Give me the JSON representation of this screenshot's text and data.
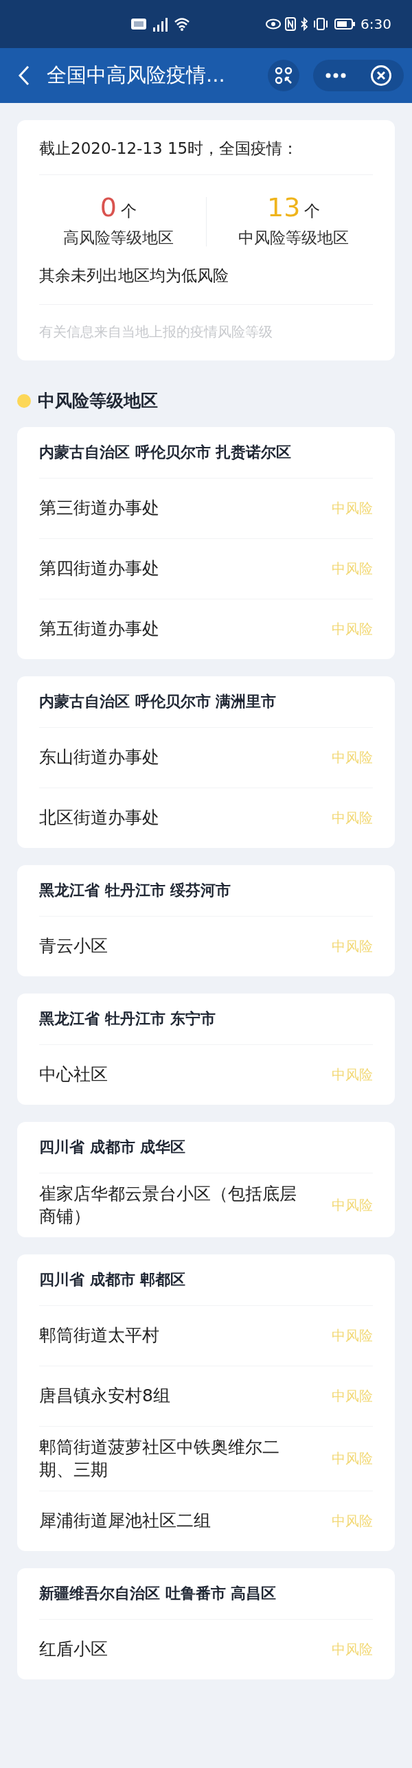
{
  "status_bar": {
    "time": "6:30"
  },
  "nav": {
    "title": "全国中高风险疫情..."
  },
  "summary": {
    "as_of": "截止2020-12-13 15时，全国疫情：",
    "stats": [
      {
        "count": "0",
        "unit": "个",
        "label": "高风险等级地区",
        "color": "#d9534f"
      },
      {
        "count": "13",
        "unit": "个",
        "label": "中风险等级地区",
        "color": "#efb41c"
      }
    ],
    "note": "其余未列出地区均为低风险",
    "source": "有关信息来自当地上报的疫情风险等级"
  },
  "section": {
    "title": "中风险等级地区"
  },
  "groups": [
    {
      "region": "内蒙古自治区 呼伦贝尔市 扎赉诺尔区",
      "areas": [
        {
          "name": "第三街道办事处",
          "risk": "中风险"
        },
        {
          "name": "第四街道办事处",
          "risk": "中风险"
        },
        {
          "name": "第五街道办事处",
          "risk": "中风险"
        }
      ]
    },
    {
      "region": "内蒙古自治区 呼伦贝尔市 满洲里市",
      "areas": [
        {
          "name": "东山街道办事处",
          "risk": "中风险"
        },
        {
          "name": "北区街道办事处",
          "risk": "中风险"
        }
      ]
    },
    {
      "region": "黑龙江省 牡丹江市 绥芬河市",
      "areas": [
        {
          "name": "青云小区",
          "risk": "中风险"
        }
      ]
    },
    {
      "region": "黑龙江省 牡丹江市 东宁市",
      "areas": [
        {
          "name": "中心社区",
          "risk": "中风险"
        }
      ]
    },
    {
      "region": "四川省 成都市 成华区",
      "areas": [
        {
          "name": "崔家店华都云景台小区（包括底层商铺）",
          "risk": "中风险"
        }
      ]
    },
    {
      "region": "四川省 成都市 郫都区",
      "areas": [
        {
          "name": "郫筒街道太平村",
          "risk": "中风险"
        },
        {
          "name": "唐昌镇永安村8组",
          "risk": "中风险"
        },
        {
          "name": "郫筒街道菠萝社区中铁奥维尔二期、三期",
          "risk": "中风险"
        },
        {
          "name": "犀浦街道犀池社区二组",
          "risk": "中风险"
        }
      ]
    },
    {
      "region": "新疆维吾尔自治区 吐鲁番市 高昌区",
      "areas": [
        {
          "name": "红盾小区",
          "risk": "中风险"
        }
      ]
    }
  ]
}
